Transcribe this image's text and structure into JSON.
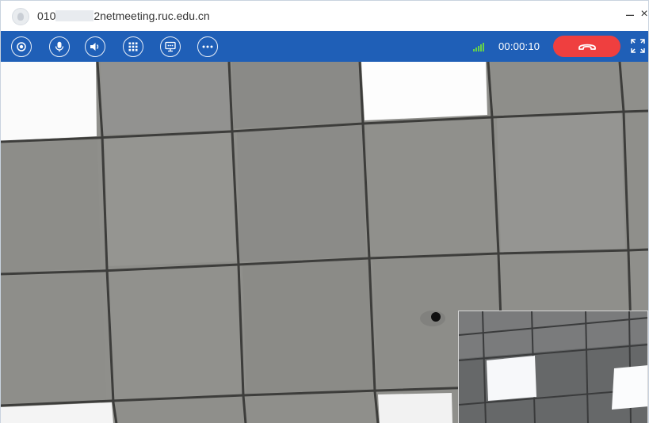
{
  "window": {
    "title_prefix": "010",
    "title_suffix": "2netmeeting.ruc.edu.cn",
    "minimize_glyph": "–",
    "close_glyph": "×"
  },
  "toolbar": {
    "buttons": [
      {
        "name": "record",
        "icon": "record-icon"
      },
      {
        "name": "microphone",
        "icon": "microphone-icon"
      },
      {
        "name": "speaker",
        "icon": "speaker-icon"
      },
      {
        "name": "dialpad",
        "icon": "dialpad-icon"
      },
      {
        "name": "screen-share",
        "icon": "screen-share-icon"
      },
      {
        "name": "more",
        "icon": "more-icon"
      }
    ],
    "signal_icon": "signal-strength-icon",
    "timer": "00:00:10",
    "hangup_icon": "phone-hangup-icon",
    "fullscreen_icon": "fullscreen-icon"
  },
  "colors": {
    "toolbar_bg": "#1f5fb7",
    "hangup": "#ef3f3f",
    "signal": "#66d24a"
  }
}
